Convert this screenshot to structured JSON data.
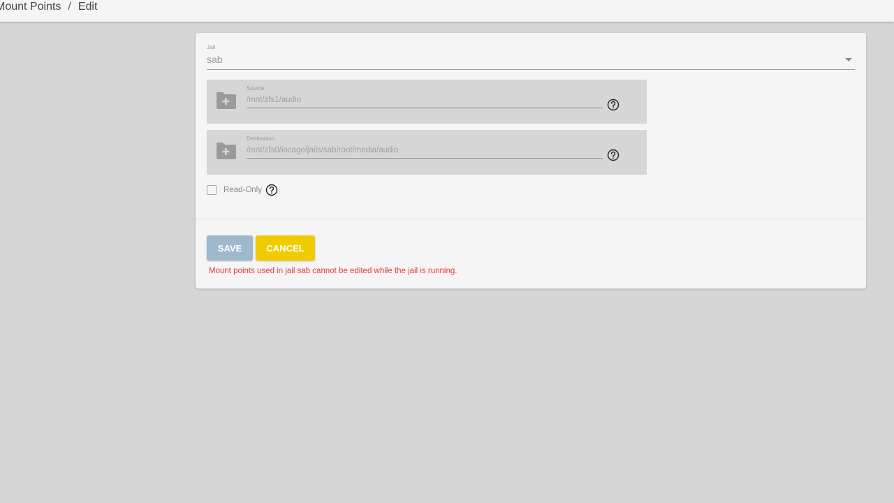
{
  "breadcrumb": {
    "items": [
      "Mount Points",
      "Edit"
    ],
    "separator": "/"
  },
  "form": {
    "jail": {
      "label": "Jail",
      "value": "sab"
    },
    "source": {
      "label": "Source",
      "value": "/mnt/zfs1/audio",
      "icon": "folder-plus-icon"
    },
    "destination": {
      "label": "Destination",
      "value": "/mnt/zfs0/iocage/jails/sab/root/media/audio",
      "icon": "folder-plus-icon"
    },
    "read_only": {
      "label": "Read-Only",
      "checked": false
    }
  },
  "actions": {
    "save_label": "SAVE",
    "cancel_label": "CANCEL"
  },
  "error_message": "Mount points used in jail sab cannot be edited while the jail is running.",
  "colors": {
    "save_button": "#9fb8cc",
    "cancel_button": "#f0cb00",
    "error_text": "#e53935",
    "background": "#d6d6d6",
    "card": "#f5f5f5"
  }
}
